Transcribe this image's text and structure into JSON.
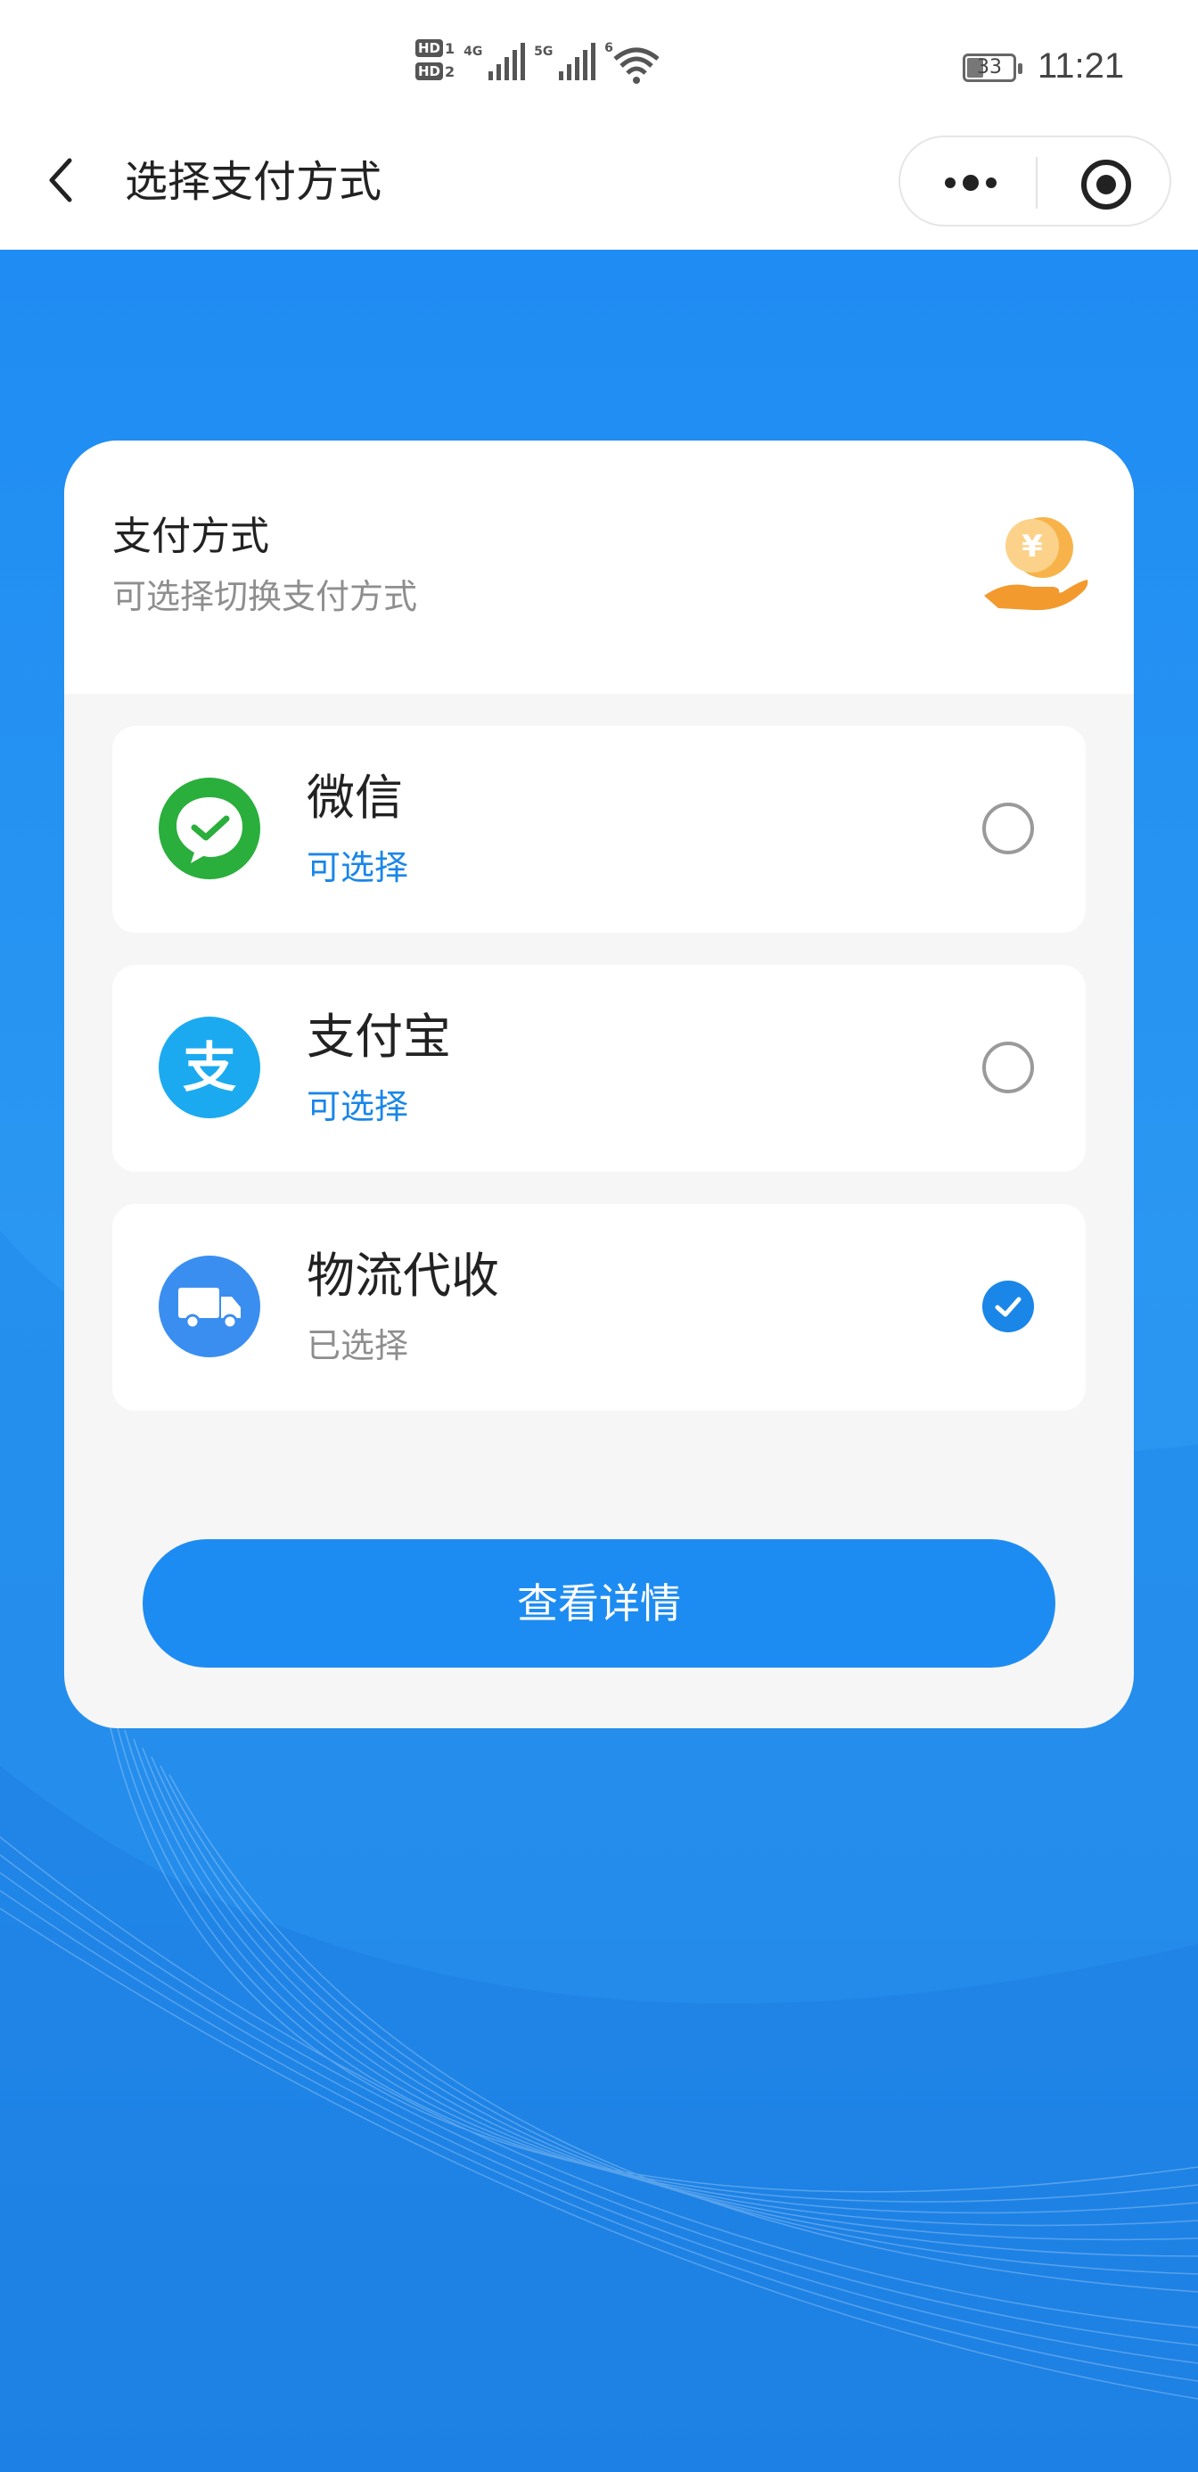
{
  "status_bar": {
    "hd1": "HD",
    "hd1_num": "1",
    "hd2": "HD",
    "hd2_num": "2",
    "net1": "4G",
    "net2": "5G",
    "wifi_tag": "6",
    "battery_level": "33",
    "time": "11:21",
    "icons": [
      "signal-icon",
      "wifi-icon",
      "battery-icon"
    ]
  },
  "nav": {
    "title": "选择支付方式",
    "back_icon": "chevron-left-icon",
    "more_icon": "more-icon",
    "close_icon": "target-icon"
  },
  "card": {
    "title": "支付方式",
    "subtitle": "可选择切换支付方式",
    "coin_icon": "yuan-coin-hand-icon",
    "coin_symbol": "¥",
    "options": [
      {
        "name": "微信",
        "status": "可选择",
        "icon": "wechat-icon",
        "selected": false
      },
      {
        "name": "支付宝",
        "status": "可选择",
        "icon": "alipay-icon",
        "icon_glyph": "支",
        "selected": false
      },
      {
        "name": "物流代收",
        "status": "已选择",
        "icon": "truck-icon",
        "selected": true
      }
    ],
    "detail_button": "查看详情"
  },
  "colors": {
    "primary": "#1d8cf2",
    "wechat_green": "#2aae3c",
    "alipay_blue": "#1baaf0",
    "truck_blue": "#3a8ef0",
    "coin_orange": "#f39a2e"
  }
}
